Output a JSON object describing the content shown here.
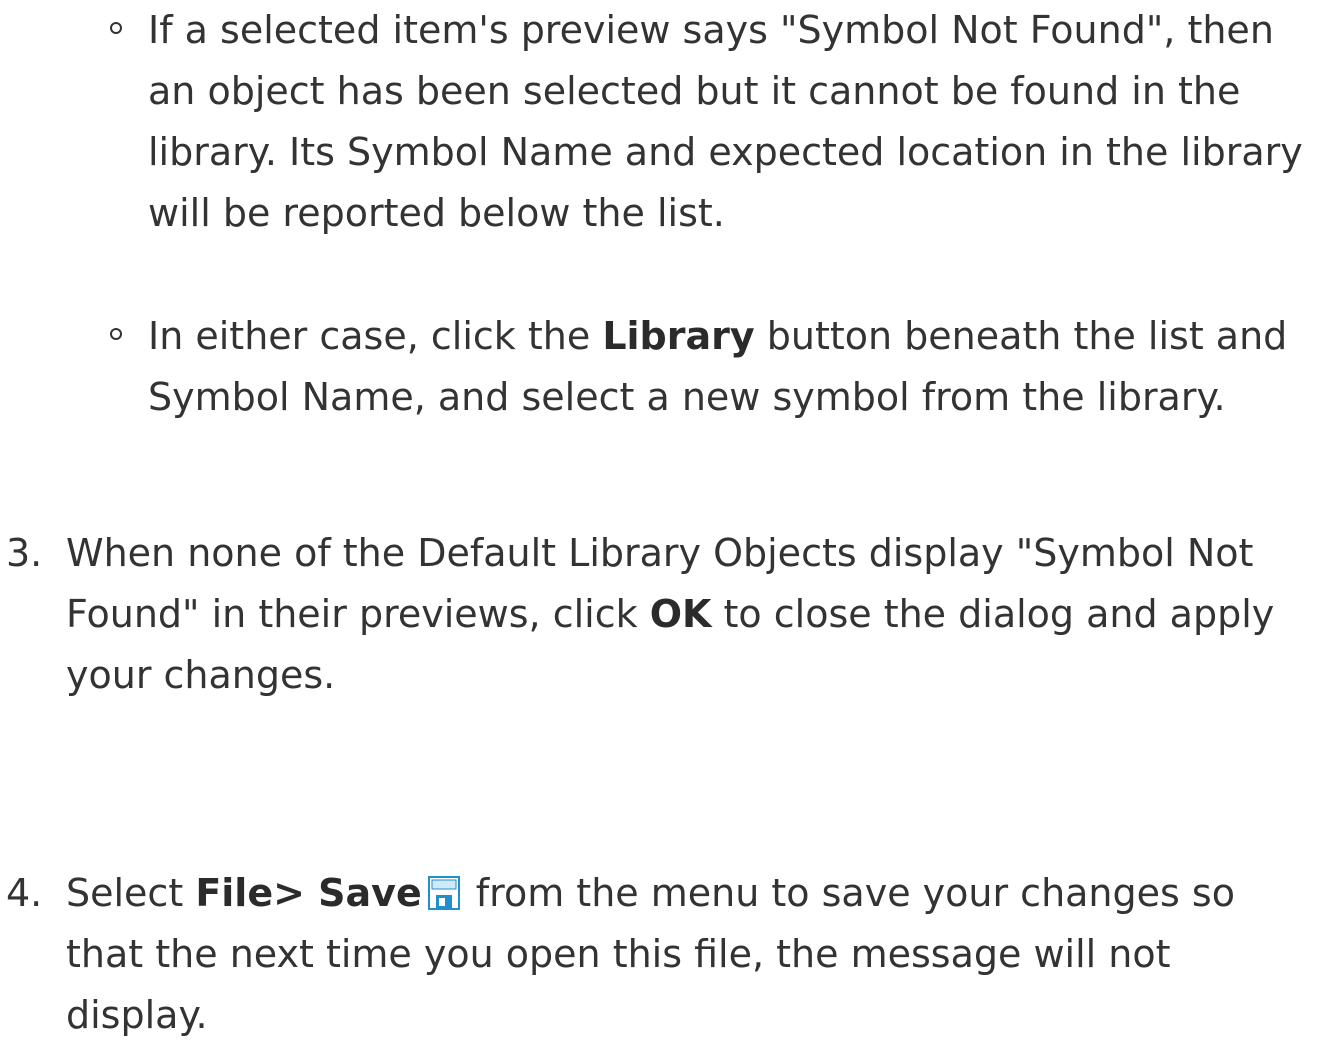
{
  "sub_list": [
    {
      "text": "If a selected item's preview says \"Symbol Not Found\", then an object has been selected but it cannot be found in the library. Its Symbol Name and expected location in the library will be reported below the list."
    },
    {
      "before": "In either case, click the ",
      "bold": "Library",
      "after": " button beneath the list and Symbol Name, and select a new symbol from the library."
    }
  ],
  "steps": [
    {
      "number": "3.",
      "before": "When none of the Default Library Objects display \"Symbol Not Found\" in their previews, click ",
      "bold": "OK",
      "after": " to close the dialog and apply your changes."
    },
    {
      "number": "4.",
      "before": "Select ",
      "bold": "File> Save",
      "icon": "save-icon",
      "after": " from the menu to save your changes so that the next time you open this file, the message will not display."
    }
  ]
}
